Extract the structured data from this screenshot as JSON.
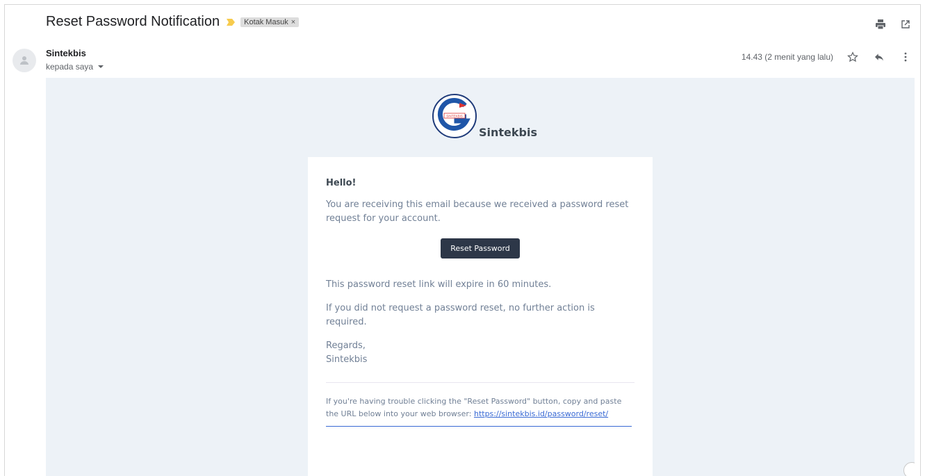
{
  "email": {
    "subject": "Reset Password Notification",
    "label": "Kotak Masuk",
    "label_close": "×",
    "sender_name": "Sintekbis",
    "recipient": "kepada saya",
    "timestamp": "14.43 (2 menit yang lalu)"
  },
  "brand": {
    "name": "Sintekbis",
    "logo_text": "SINTEKBIS"
  },
  "body": {
    "greeting": "Hello!",
    "intro": "You are receiving this email because we received a password reset request for your account.",
    "button_label": "Reset Password",
    "expire_text": "This password reset link will expire in 60 minutes.",
    "no_action_text": "If you did not request a password reset, no further action is required.",
    "regards": "Regards,",
    "signature": "Sintekbis",
    "trouble_text": "If you're having trouble clicking the \"Reset Password\" button, copy and paste the URL below into your web browser:",
    "url_text": "https://sintekbis.id/password/reset/"
  },
  "icons": {
    "print": "print-icon",
    "open_new": "open-in-new-icon",
    "star": "star-icon",
    "reply": "reply-icon",
    "more": "more-vert-icon",
    "importance": "importance-marker-icon",
    "avatar": "person-icon"
  },
  "colors": {
    "body_bg": "#edf2f7",
    "button_bg": "#2d3748",
    "link": "#3869d4",
    "text_muted": "#718096",
    "importance": "#f7cb4d"
  }
}
